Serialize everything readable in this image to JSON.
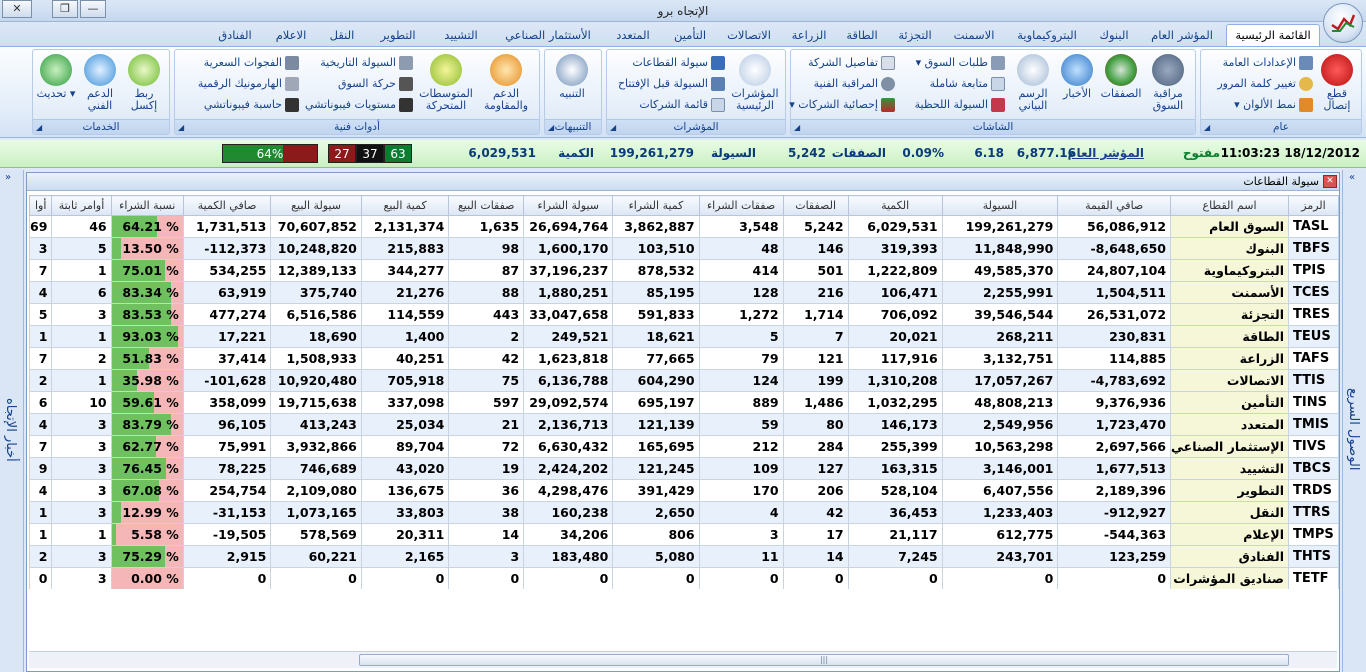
{
  "window": {
    "title": "الإتجاه برو"
  },
  "tabs": [
    "القائمة الرئيسية",
    "المؤشر العام",
    "البنوك",
    "البتروكيماوية",
    "الاسمنت",
    "التجزئة",
    "الطاقة",
    "الزراعة",
    "الاتصالات",
    "التأمين",
    "المتعدد",
    "الأستثمار الصناعي",
    "التشييد",
    "التطوير",
    "النقل",
    "الاعلام",
    "الفنادق"
  ],
  "ribbon": {
    "general": {
      "title": "عام",
      "connect": "قطع إتصال",
      "settings": "الإعدادات العامة",
      "password": "تغيير كلمة المرور",
      "colors": "نمط الألوان"
    },
    "screens": {
      "title": "الشاشات",
      "market_watch": "مراقبة السوق",
      "deals": "الصفقات",
      "news": "الأخبار",
      "chart": "الرسم البياني",
      "market_orders": "طلبات السوق",
      "full_follow": "متابعة شاملة",
      "instant_liquidity": "السيولة اللحظية",
      "company_details": "تفاصيل الشركة",
      "tech_watch": "المراقبة الفنية",
      "company_stats": "إحصائية الشركات"
    },
    "indices": {
      "title": "المؤشرات",
      "main_indices": "المؤشرات الرئيسية",
      "sector_liquidity": "سيولة القطاعات",
      "preopen_liquidity": "السيولة قبل الإفتتاح",
      "company_list": "قائمة الشركات"
    },
    "alerts": {
      "title": "التنبيهات",
      "alert": "التنبيه"
    },
    "tech_tools": {
      "title": "أدوات فنية",
      "support": "الدعم والمقاومة",
      "averages": "المتوسطات المتحركة",
      "hist_liquidity": "السيولة التاريخية",
      "market_move": "حركة السوق",
      "fib_levels": "مستويات فيبوناتشي",
      "price_gaps": "الفجوات السعرية",
      "harmonic": "الهارمونيك الرقمية",
      "fib_calc": "حاسبة فيبوناتشي"
    },
    "services": {
      "title": "الخدمات",
      "excel": "ربط إكسل",
      "support": "الدعم الفني",
      "update": "تحديث"
    }
  },
  "ticker": {
    "datetime": "11:03:23 18/12/2012",
    "status": "مفتوح",
    "index_label": "المؤشر العام",
    "index_value": "6,877.16",
    "change": "6.18",
    "change_pct": "0.09%",
    "deals_label": "الصفقات",
    "deals": "5,242",
    "liq_label": "السيولة",
    "liquidity": "199,261,279",
    "qty_label": "الكمية",
    "qty": "6,029,531",
    "up": "63",
    "same": "37",
    "down": "27",
    "ratio": "64%"
  },
  "side": {
    "left": "أخبار الإتجاه",
    "right": "الوصول السريع"
  },
  "grid": {
    "title": "سيولة القطاعات",
    "columns": [
      "الرمز",
      "اسم القطاع",
      "صافي القيمة",
      "السيولة",
      "الكمية",
      "الصفقات",
      "صفقات الشراء",
      "كمية الشراء",
      "سيولة الشراء",
      "صفقات البيع",
      "كمية البيع",
      "سيولة البيع",
      "صافي الكمية",
      "نسبة الشراء",
      "أوامر ثابتة",
      "أوا"
    ],
    "rows": [
      [
        "TASL",
        "السوق العام",
        "56,086,912",
        "199,261,279",
        "6,029,531",
        "5,242",
        "3,548",
        "3,862,887",
        "26,694,764",
        "1,635",
        "2,131,374",
        "70,607,852",
        "1,731,513",
        "64.21 %",
        "46",
        "69"
      ],
      [
        "TBFS",
        "البنوك",
        "-8,648,650",
        "11,848,990",
        "319,393",
        "146",
        "48",
        "103,510",
        "1,600,170",
        "98",
        "215,883",
        "10,248,820",
        "-112,373",
        "13.50 %",
        "5",
        "3"
      ],
      [
        "TPIS",
        "البتروكيماوية",
        "24,807,104",
        "49,585,370",
        "1,222,809",
        "501",
        "414",
        "878,532",
        "37,196,237",
        "87",
        "344,277",
        "12,389,133",
        "534,255",
        "75.01 %",
        "1",
        "7"
      ],
      [
        "TCES",
        "الأسمنت",
        "1,504,511",
        "2,255,991",
        "106,471",
        "216",
        "128",
        "85,195",
        "1,880,251",
        "88",
        "21,276",
        "375,740",
        "63,919",
        "83.34 %",
        "6",
        "4"
      ],
      [
        "TRES",
        "التجزئة",
        "26,531,072",
        "39,546,544",
        "706,092",
        "1,714",
        "1,272",
        "591,833",
        "33,047,658",
        "443",
        "114,559",
        "6,516,586",
        "477,274",
        "83.53 %",
        "3",
        "5"
      ],
      [
        "TEUS",
        "الطاقة",
        "230,831",
        "268,211",
        "20,021",
        "7",
        "5",
        "18,621",
        "249,521",
        "2",
        "1,400",
        "18,690",
        "17,221",
        "93.03 %",
        "1",
        "1"
      ],
      [
        "TAFS",
        "الزراعة",
        "114,885",
        "3,132,751",
        "117,916",
        "121",
        "79",
        "77,665",
        "1,623,818",
        "42",
        "40,251",
        "1,508,933",
        "37,414",
        "51.83 %",
        "2",
        "7"
      ],
      [
        "TTIS",
        "الاتصالات",
        "-4,783,692",
        "17,057,267",
        "1,310,208",
        "199",
        "124",
        "604,290",
        "6,136,788",
        "75",
        "705,918",
        "10,920,480",
        "-101,628",
        "35.98 %",
        "1",
        "2"
      ],
      [
        "TINS",
        "التأمين",
        "9,376,936",
        "48,808,213",
        "1,032,295",
        "1,486",
        "889",
        "695,197",
        "29,092,574",
        "597",
        "337,098",
        "19,715,638",
        "358,099",
        "59.61 %",
        "10",
        "6"
      ],
      [
        "TMIS",
        "المتعدد",
        "1,723,470",
        "2,549,956",
        "146,173",
        "80",
        "59",
        "121,139",
        "2,136,713",
        "21",
        "25,034",
        "413,243",
        "96,105",
        "83.79 %",
        "3",
        "4"
      ],
      [
        "TIVS",
        "الإستثمار الصناعي",
        "2,697,566",
        "10,563,298",
        "255,399",
        "284",
        "212",
        "165,695",
        "6,630,432",
        "72",
        "89,704",
        "3,932,866",
        "75,991",
        "62.77 %",
        "3",
        "7"
      ],
      [
        "TBCS",
        "التشييد",
        "1,677,513",
        "3,146,001",
        "163,315",
        "127",
        "109",
        "121,245",
        "2,424,202",
        "19",
        "43,020",
        "746,689",
        "78,225",
        "76.45 %",
        "3",
        "9"
      ],
      [
        "TRDS",
        "التطوير",
        "2,189,396",
        "6,407,556",
        "528,104",
        "206",
        "170",
        "391,429",
        "4,298,476",
        "36",
        "136,675",
        "2,109,080",
        "254,754",
        "67.08 %",
        "3",
        "4"
      ],
      [
        "TTRS",
        "النقل",
        "-912,927",
        "1,233,403",
        "36,453",
        "42",
        "4",
        "2,650",
        "160,238",
        "38",
        "33,803",
        "1,073,165",
        "-31,153",
        "12.99 %",
        "3",
        "1"
      ],
      [
        "TMPS",
        "الإعلام",
        "-544,363",
        "612,775",
        "21,117",
        "17",
        "3",
        "806",
        "34,206",
        "14",
        "20,311",
        "578,569",
        "-19,505",
        "5.58 %",
        "1",
        "1"
      ],
      [
        "THTS",
        "الفنادق",
        "123,259",
        "243,701",
        "7,245",
        "14",
        "11",
        "5,080",
        "183,480",
        "3",
        "2,165",
        "60,221",
        "2,915",
        "75.29 %",
        "3",
        "2"
      ],
      [
        "TETF",
        "صناديق المؤشرات",
        "0",
        "0",
        "0",
        "0",
        "0",
        "0",
        "0",
        "0",
        "0",
        "0",
        "0",
        "0.00 %",
        "3",
        "0"
      ]
    ],
    "pcts": [
      0.6421,
      0.135,
      0.7501,
      0.8334,
      0.8353,
      0.9303,
      0.5183,
      0.3598,
      0.5961,
      0.8379,
      0.6277,
      0.7645,
      0.6708,
      0.1299,
      0.0558,
      0.7529,
      0
    ]
  },
  "colors": {
    "up": "#0a7d2e",
    "same": "#111111",
    "down": "#8b1a1a",
    "ratio": "#8b1a1a",
    "buy_bar": "#6fc05f",
    "sell_bar": "#f4b6b6"
  }
}
